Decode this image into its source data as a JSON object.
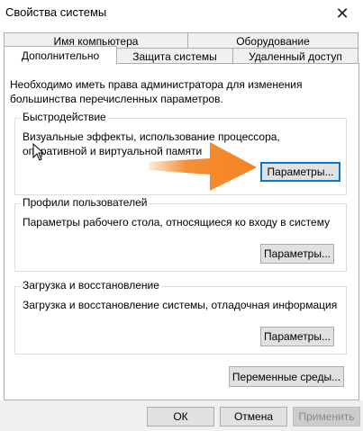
{
  "window": {
    "title": "Свойства системы",
    "close_icon": "close-icon"
  },
  "tabs": {
    "back_row": [
      "Имя компьютера",
      "Оборудование"
    ],
    "front_row": [
      "Дополнительно",
      "Защита системы",
      "Удаленный доступ"
    ],
    "active": "Дополнительно"
  },
  "panel": {
    "note": "Необходимо иметь права администратора для изменения большинства перечисленных параметров.",
    "performance": {
      "title": "Быстродействие",
      "text": "Визуальные эффекты, использование процессора, оперативной и виртуальной памяти",
      "button": "Параметры..."
    },
    "profiles": {
      "title": "Профили пользователей",
      "text": "Параметры рабочего стола, относящиеся ко входу в систему",
      "button": "Параметры..."
    },
    "startup": {
      "title": "Загрузка и восстановление",
      "text": "Загрузка и восстановление системы, отладочная информация",
      "button": "Параметры..."
    },
    "env_button": "Переменные среды..."
  },
  "footer": {
    "ok": "ОК",
    "cancel": "Отмена",
    "apply": "Применить"
  },
  "colors": {
    "arrow": "#f58220",
    "focus_border": "#0078d7"
  }
}
